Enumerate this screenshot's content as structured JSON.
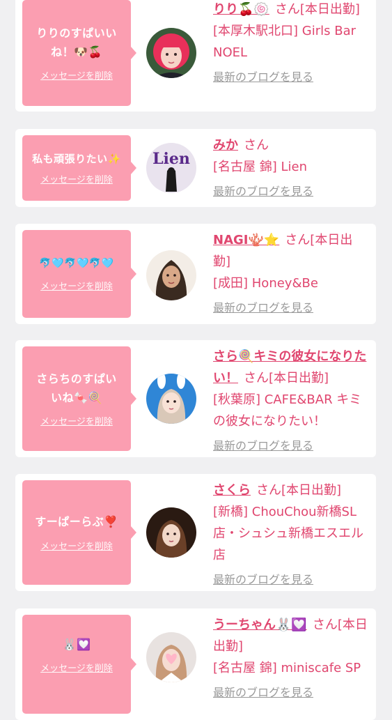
{
  "cards": [
    {
      "message": "りりのすぱいいね！🐶🍒",
      "delete_label": "メッセージを削除",
      "name": "りり🍒🍥",
      "san": "さん",
      "status": "[本日出勤]",
      "shop": "[本厚木駅北口] Girls Bar NOEL",
      "blog_label": "最新のブログを見る",
      "avatar": "woman-pink-hair"
    },
    {
      "message": "私も頑張りたい✨",
      "delete_label": "メッセージを削除",
      "name": "みか",
      "san": "さん",
      "status": "",
      "shop": "[名古屋 錦] Lien",
      "blog_label": "最新のブログを見る",
      "avatar": "lien-logo"
    },
    {
      "message": "🐬🩵🐬🩵🐬🩵",
      "delete_label": "メッセージを削除",
      "name": "NAGI🪸⭐",
      "san": "さん",
      "status": "[本日出勤]",
      "shop": "[成田] Honey&Be",
      "blog_label": "最新のブログを見る",
      "avatar": "woman-dark-hair"
    },
    {
      "message": "さらちのすぱいいね🍬🍭",
      "delete_label": "メッセージを削除",
      "name": "さら🍭キミの彼女になりたい！",
      "san": "さん",
      "status": "[本日出勤]",
      "shop": "[秋葉原] CAFE&BAR キミの彼女になりたい！",
      "blog_label": "最新のブログを見る",
      "avatar": "woman-bunny-ears"
    },
    {
      "message": "すーぱーらぶ❣️",
      "delete_label": "メッセージを削除",
      "name": "さくら",
      "san": "さん",
      "status": "[本日出勤]",
      "shop": "[新橋] ChouChou新橋SL店・シュシュ新橋エスエル店",
      "blog_label": "最新のブログを見る",
      "avatar": "woman-brown-hair"
    },
    {
      "message": "🐰💟",
      "delete_label": "メッセージを削除",
      "name": "うーちゃん🐰💟",
      "san": "さん",
      "status": "[本日出勤]",
      "shop": "[名古屋 錦] miniscafe SP",
      "blog_label": "最新のブログを見る",
      "avatar": "woman-heart-sticker"
    }
  ],
  "colors": {
    "background": "#f0f0f2",
    "bubble": "#fb9eb1",
    "name": "#e0466f",
    "blog_link": "#9a9a9a"
  }
}
